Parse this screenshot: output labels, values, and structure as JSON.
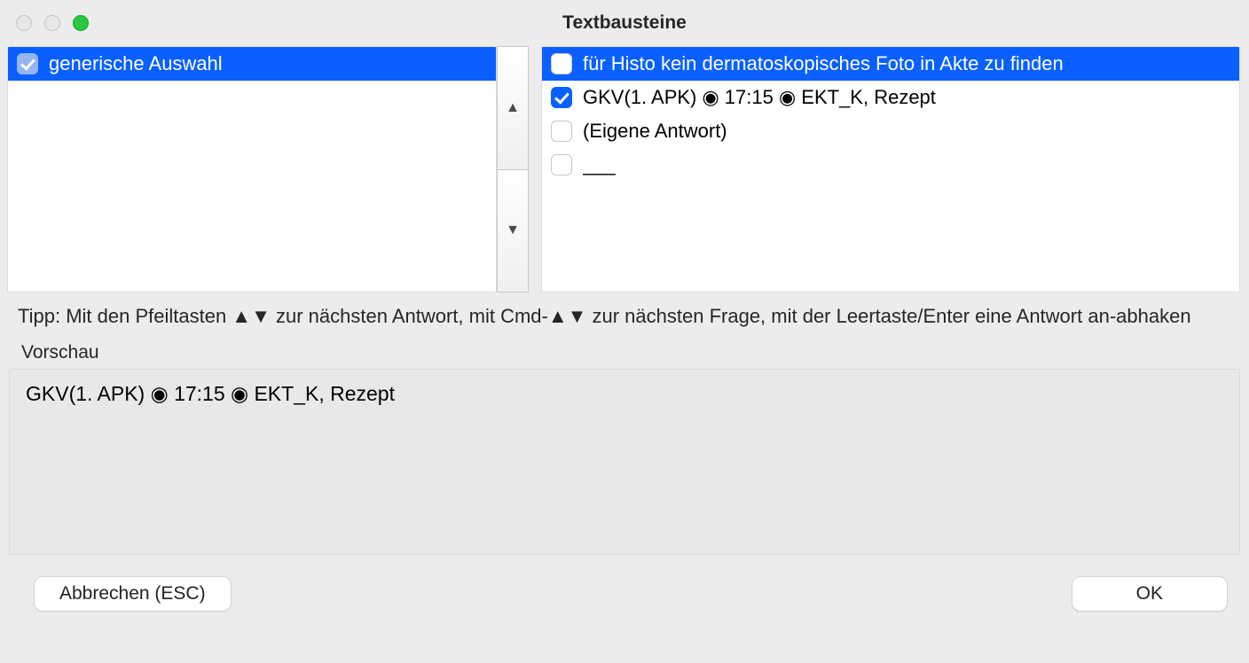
{
  "window": {
    "title": "Textbausteine"
  },
  "questions": [
    {
      "label": "generische Auswahl",
      "checked": true,
      "selected": true
    }
  ],
  "answers": [
    {
      "label": "für Histo kein dermatoskopisches Foto in Akte zu finden",
      "checked": false,
      "selected": true
    },
    {
      "label": "GKV(1. APK) ◉ 17:15 ◉ EKT_K, Rezept",
      "checked": true,
      "selected": false
    },
    {
      "label": "(Eigene Antwort)",
      "checked": false,
      "selected": false
    },
    {
      "label": "___",
      "checked": false,
      "selected": false
    }
  ],
  "tip": "Tipp: Mit den Pfeiltasten ▲▼ zur nächsten Antwort, mit Cmd-▲▼  zur nächsten Frage, mit der Leertaste/Enter eine Antwort an-abhaken",
  "preview": {
    "label": "Vorschau",
    "text": "GKV(1. APK) ◉ 17:15 ◉ EKT_K, Rezept"
  },
  "buttons": {
    "cancel": "Abbrechen (ESC)",
    "ok": "OK"
  },
  "arrows": {
    "up": "▲",
    "down": "▼"
  }
}
